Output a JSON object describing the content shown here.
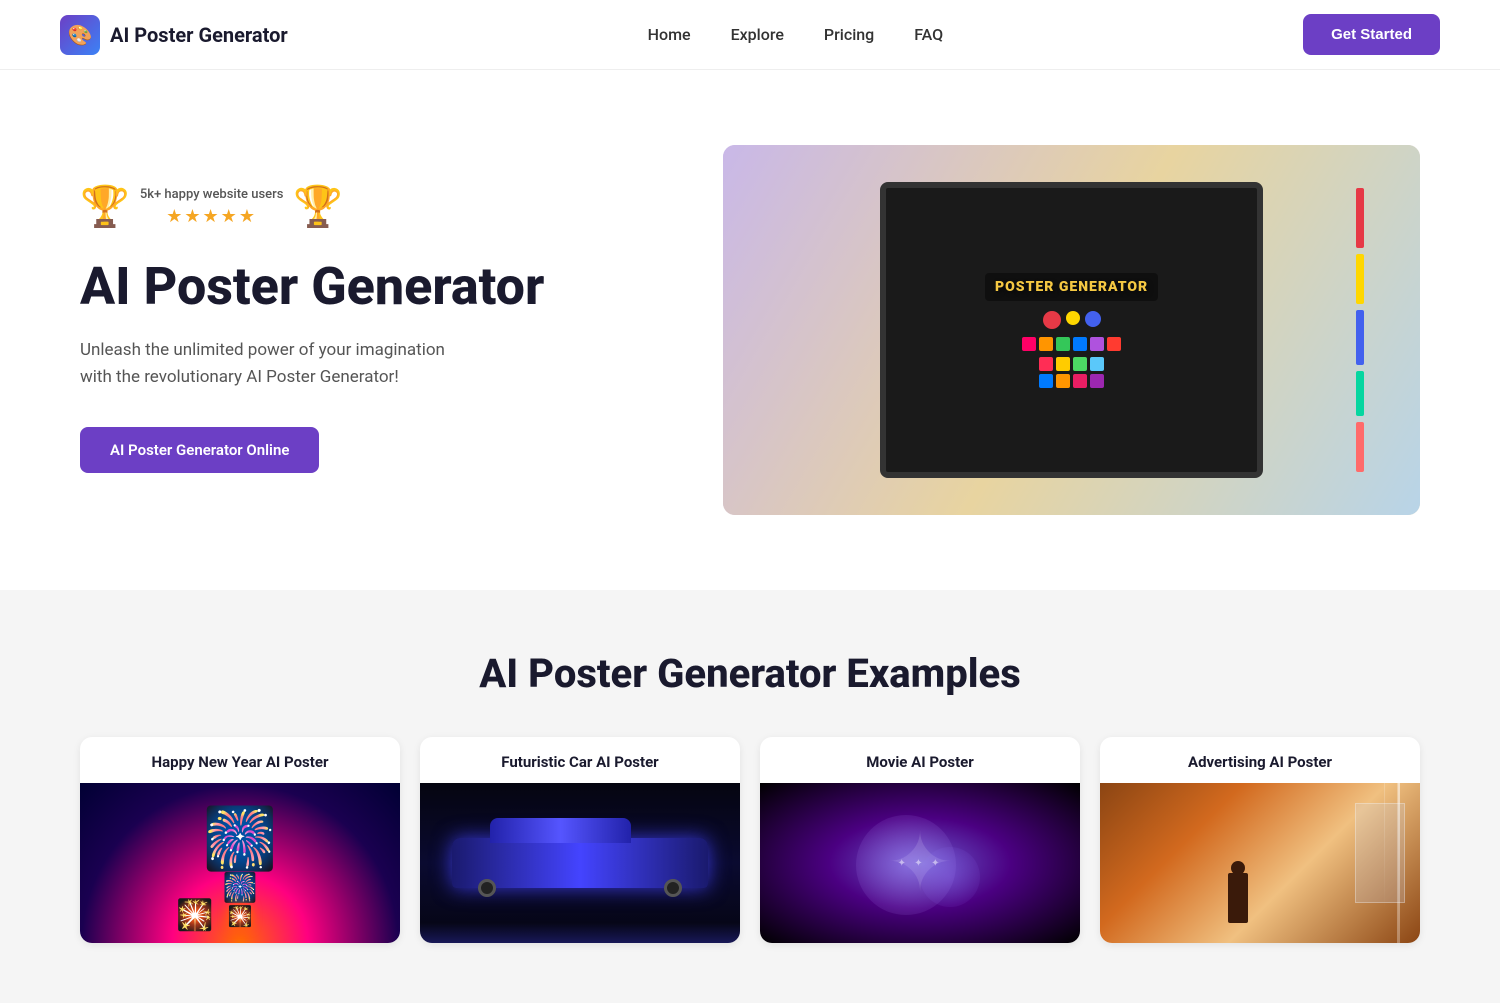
{
  "navbar": {
    "brand": {
      "logo_emoji": "🎨",
      "name": "AI Poster Generator"
    },
    "nav_items": [
      {
        "label": "Home",
        "href": "#"
      },
      {
        "label": "Explore",
        "href": "#"
      },
      {
        "label": "Pricing",
        "href": "#"
      },
      {
        "label": "FAQ",
        "href": "#"
      }
    ],
    "cta_label": "Get Started"
  },
  "hero": {
    "badge": {
      "text": "5k+ happy website users",
      "stars": "★★★★★"
    },
    "title": "AI Poster Generator",
    "description_line1": "Unleash the unlimited power of your imagination",
    "description_line2": "with the revolutionary AI Poster Generator!",
    "cta_label": "AI Poster Generator Online"
  },
  "examples": {
    "section_title": "AI Poster Generator Examples",
    "cards": [
      {
        "title": "Happy New Year AI Poster",
        "type": "new-year"
      },
      {
        "title": "Futuristic Car AI Poster",
        "type": "car"
      },
      {
        "title": "Movie AI Poster",
        "type": "movie"
      },
      {
        "title": "Advertising AI Poster",
        "type": "advertising"
      }
    ]
  }
}
